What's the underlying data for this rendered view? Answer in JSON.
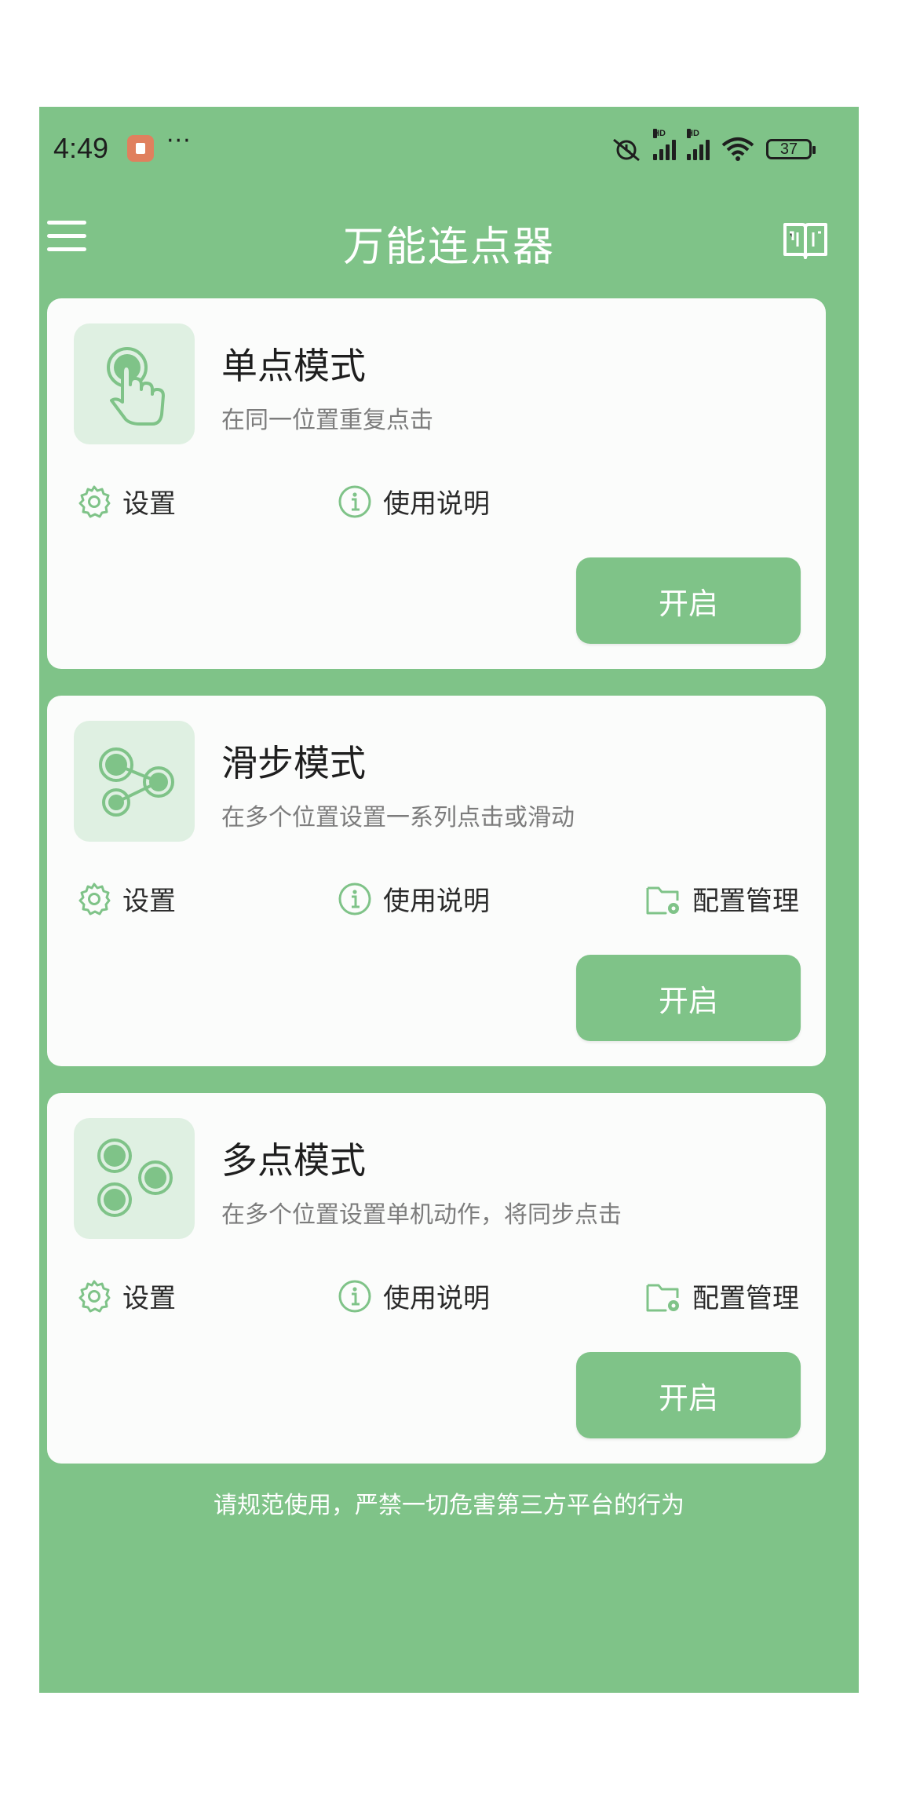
{
  "status_bar": {
    "time": "4:49",
    "more": "···",
    "hd_label": "HD",
    "battery": "37"
  },
  "app_bar": {
    "title": "万能连点器"
  },
  "cards": [
    {
      "title": "单点模式",
      "desc": "在同一位置重复点击",
      "icon": "tap-hand-icon",
      "settings_label": "设置",
      "help_label": "使用说明",
      "start_label": "开启"
    },
    {
      "title": "滑步模式",
      "desc": "在多个位置设置一系列点击或滑动",
      "icon": "connected-dots-icon",
      "settings_label": "设置",
      "help_label": "使用说明",
      "config_label": "配置管理",
      "start_label": "开启"
    },
    {
      "title": "多点模式",
      "desc": "在多个位置设置单机动作，将同步点击",
      "icon": "multi-dots-icon",
      "settings_label": "设置",
      "help_label": "使用说明",
      "config_label": "配置管理",
      "start_label": "开启"
    }
  ],
  "footer": "请规范使用，严禁一切危害第三方平台的行为",
  "colors": {
    "brand_green": "#7fc388",
    "card_bg": "#fbfcfb",
    "icon_tile_bg": "#dff0e2"
  }
}
